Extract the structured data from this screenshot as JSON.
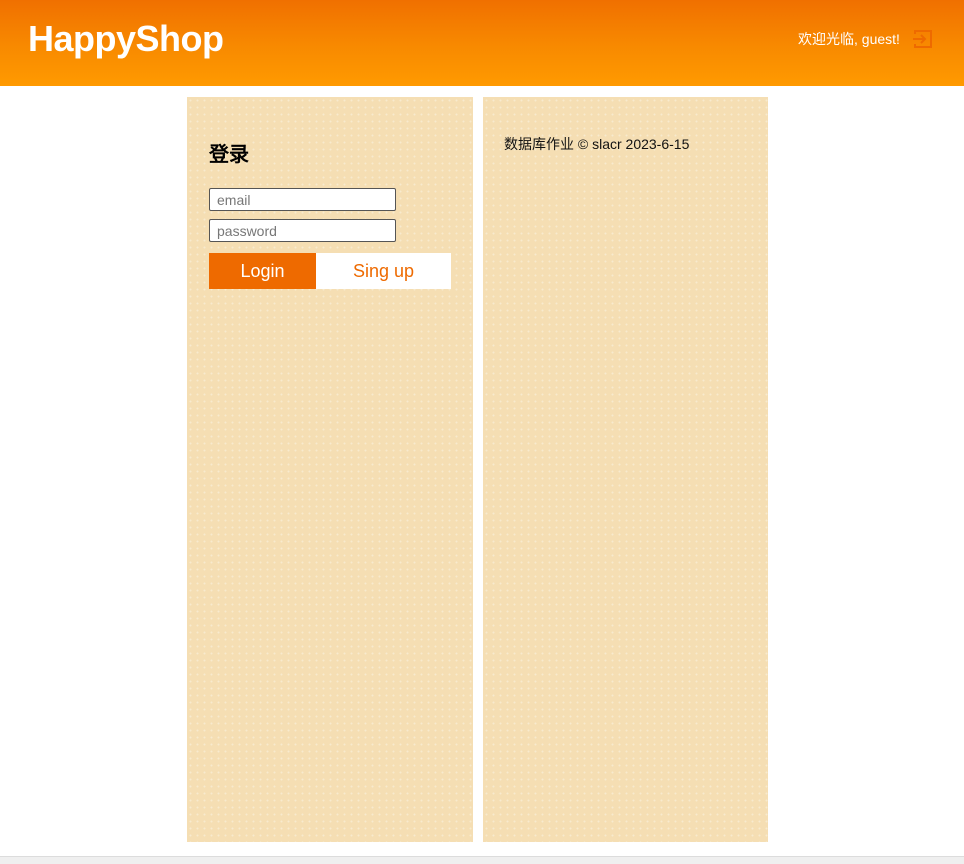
{
  "header": {
    "brand": "HappyShop",
    "welcome": "欢迎光临, guest!",
    "logout_icon": "sign-out-icon"
  },
  "login": {
    "title": "登录",
    "email_placeholder": "email",
    "password_placeholder": "password",
    "login_label": "Login",
    "signup_label": "Sing up"
  },
  "info": {
    "footer": "数据库作业 © slacr 2023-6-15"
  },
  "colors": {
    "accent": "#ee6a00",
    "header_top": "#f07000",
    "header_bottom": "#ff9a00",
    "panel": "#f5deb3"
  }
}
